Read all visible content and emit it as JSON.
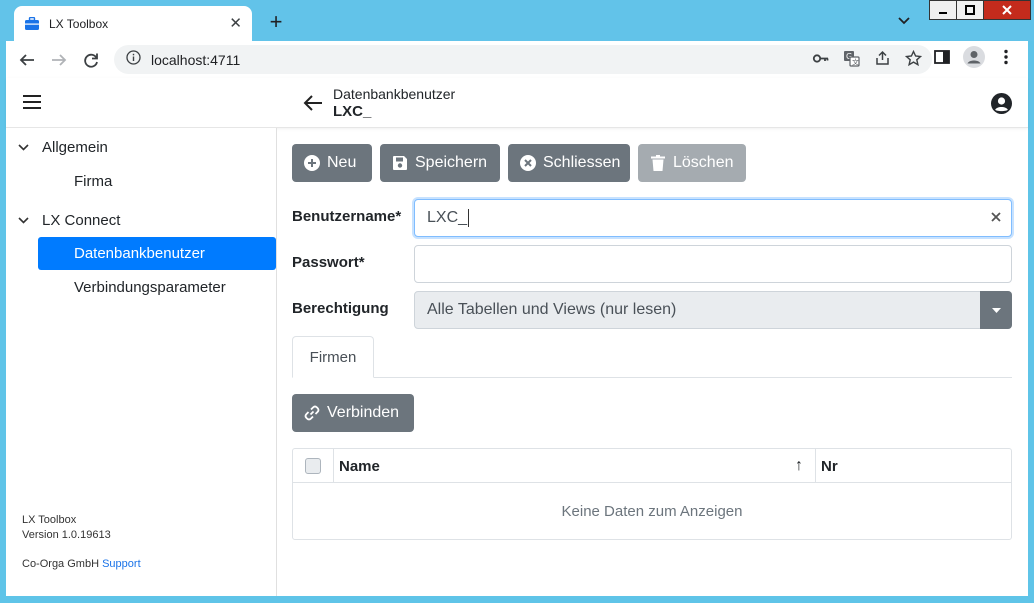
{
  "browser": {
    "tab_title": "LX Toolbox",
    "new_tab_symbol": "+",
    "close_symbol": "✕",
    "url": "localhost:4711"
  },
  "appbar": {
    "subtitle": "Datenbankbenutzer",
    "title": "LXC_"
  },
  "sidebar": {
    "groups": [
      {
        "label": "Allgemein",
        "items": [
          {
            "label": "Firma",
            "active": false
          }
        ]
      },
      {
        "label": "LX Connect",
        "items": [
          {
            "label": "Datenbankbenutzer",
            "active": true
          },
          {
            "label": "Verbindungsparameter",
            "active": false
          }
        ]
      }
    ],
    "footer": {
      "app_name": "LX Toolbox",
      "version": "Version 1.0.19613",
      "company": "Co-Orga GmbH",
      "support_link": "Support"
    }
  },
  "toolbar": {
    "new_label": "Neu",
    "save_label": "Speichern",
    "close_label": "Schliessen",
    "delete_label": "Löschen"
  },
  "form": {
    "username_label": "Benutzername*",
    "username_value": "LXC_",
    "password_label": "Passwort*",
    "password_value": "",
    "permission_label": "Berechtigung",
    "permission_value": "Alle Tabellen und Views (nur lesen)"
  },
  "tabs": [
    {
      "label": "Firmen",
      "active": true
    }
  ],
  "connect_label": "Verbinden",
  "grid": {
    "columns": [
      "Name",
      "Nr"
    ],
    "sort_indicator": "↑",
    "empty_text": "Keine Daten zum Anzeigen"
  },
  "colors": {
    "accent": "#007bff",
    "button": "#6c757d",
    "button_disabled": "#a5abb0",
    "chrome_frame": "#62c3e9"
  }
}
